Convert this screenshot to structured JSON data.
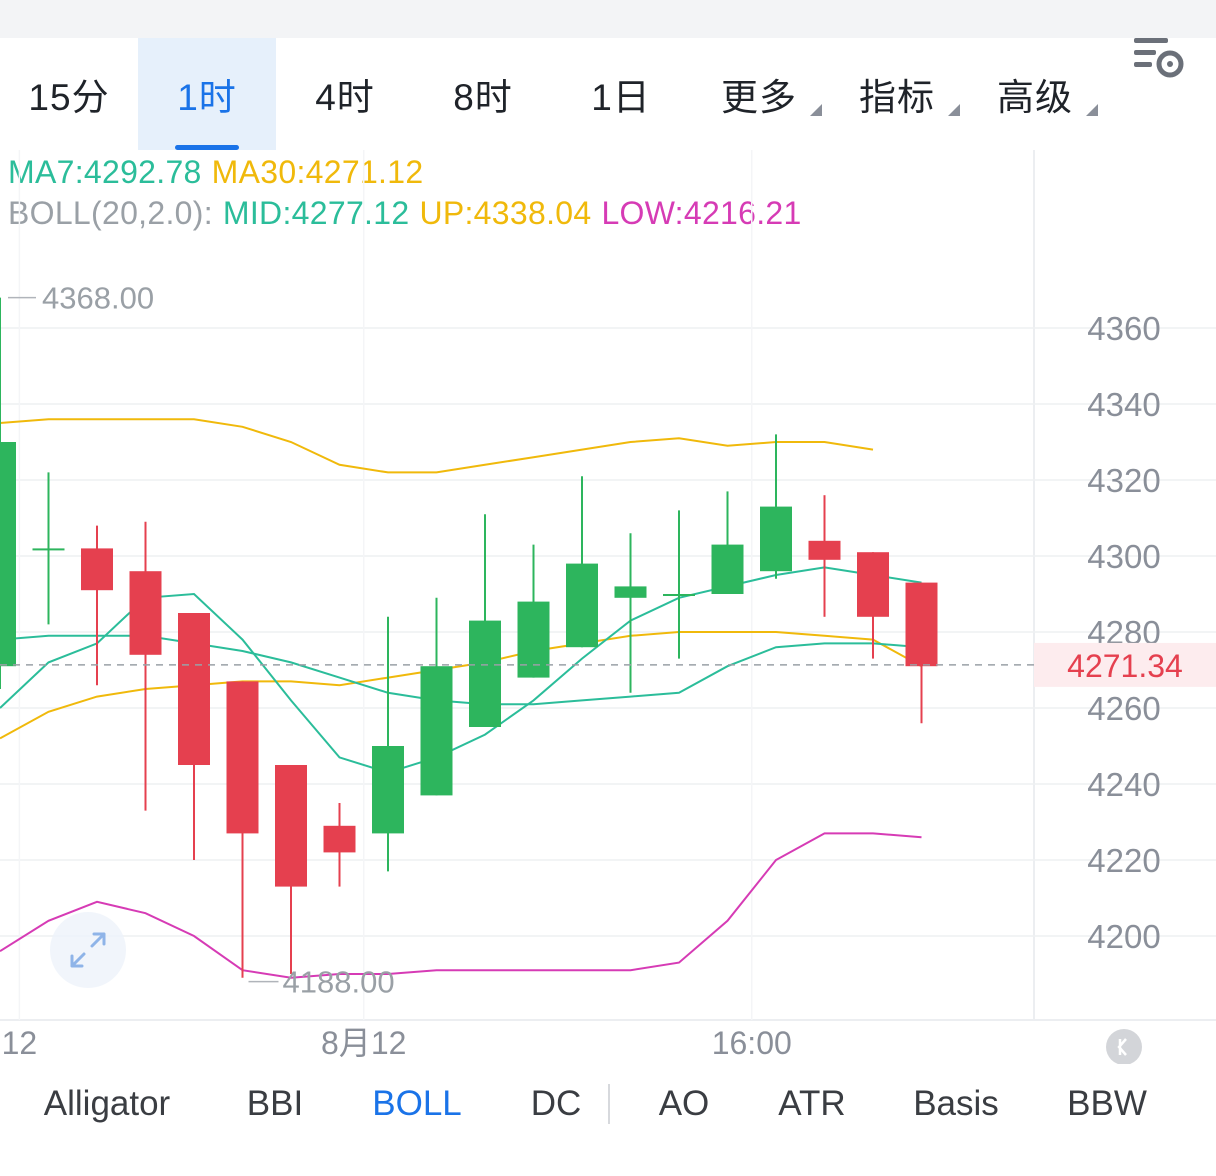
{
  "timeframe_tabs": [
    {
      "label": "15分",
      "active": false,
      "dropdown": false
    },
    {
      "label": "1时",
      "active": true,
      "dropdown": false
    },
    {
      "label": "4时",
      "active": false,
      "dropdown": false
    },
    {
      "label": "8时",
      "active": false,
      "dropdown": false
    },
    {
      "label": "1日",
      "active": false,
      "dropdown": false
    },
    {
      "label": "更多",
      "active": false,
      "dropdown": true
    },
    {
      "label": "指标",
      "active": false,
      "dropdown": true
    },
    {
      "label": "高级",
      "active": false,
      "dropdown": true
    }
  ],
  "settings_icon": "chart-settings-icon",
  "expand_icon": "expand-icon",
  "scroll_icon": "scroll-to-latest-icon",
  "legend": {
    "ma": [
      {
        "text": "MA7:4292.78",
        "color": "#2bbd9a"
      },
      {
        "text": "MA30:4271.12",
        "color": "#f0b90b"
      }
    ],
    "boll": [
      {
        "text": "BOLL(20,2.0):",
        "color": "#9aa0a6"
      },
      {
        "text": "MID:4277.12",
        "color": "#2bbd9a"
      },
      {
        "text": "UP:4338.04",
        "color": "#f0b90b"
      },
      {
        "text": "LOW:4216.21",
        "color": "#d63bb5"
      }
    ]
  },
  "indicators": [
    {
      "label": "Alligator",
      "active": false
    },
    {
      "label": "BBI",
      "active": false
    },
    {
      "label": "BOLL",
      "active": true
    },
    {
      "label": "DC",
      "active": false
    },
    {
      "label": "AO",
      "active": false
    },
    {
      "label": "ATR",
      "active": false
    },
    {
      "label": "Basis",
      "active": false
    },
    {
      "label": "BBW",
      "active": false
    }
  ],
  "colors": {
    "up": "#2db55d",
    "down": "#e5404f",
    "grid": "#eef0f2",
    "mid": "#2bbd9a",
    "upper": "#f0b90b",
    "lower": "#d63bb5",
    "ma": "#2bbd9a",
    "accent": "#1a73e8"
  },
  "chart_data": {
    "type": "candlestick",
    "ylim": [
      4182,
      4382
    ],
    "y_ticks": [
      4360,
      4340,
      4320,
      4300,
      4280,
      4260,
      4240,
      4220,
      4200
    ],
    "y_tick_labels": [
      "4360",
      "4340",
      "4320",
      "4300",
      "4280",
      "4260",
      "4240",
      "4220",
      "4200"
    ],
    "x_labels": [
      {
        "text": "12",
        "index": -0.6
      },
      {
        "text": "8月12",
        "index": 6.5
      },
      {
        "text": "16:00",
        "index": 14.5
      }
    ],
    "candles": [
      {
        "o": 4271,
        "h": 4368,
        "l": 4265,
        "c": 4330
      },
      {
        "o": 4302,
        "h": 4322,
        "l": 4282,
        "c": 4302
      },
      {
        "o": 4302,
        "h": 4308,
        "l": 4266,
        "c": 4291
      },
      {
        "o": 4296,
        "h": 4309,
        "l": 4233,
        "c": 4274
      },
      {
        "o": 4285,
        "h": 4285,
        "l": 4220,
        "c": 4245
      },
      {
        "o": 4267,
        "h": 4267,
        "l": 4189,
        "c": 4227
      },
      {
        "o": 4245,
        "h": 4245,
        "l": 4190,
        "c": 4213
      },
      {
        "o": 4229,
        "h": 4235,
        "l": 4213,
        "c": 4222
      },
      {
        "o": 4227,
        "h": 4284,
        "l": 4217,
        "c": 4250
      },
      {
        "o": 4237,
        "h": 4289,
        "l": 4237,
        "c": 4271
      },
      {
        "o": 4255,
        "h": 4311,
        "l": 4255,
        "c": 4283
      },
      {
        "o": 4268,
        "h": 4303,
        "l": 4268,
        "c": 4288
      },
      {
        "o": 4276,
        "h": 4321,
        "l": 4276,
        "c": 4298
      },
      {
        "o": 4289,
        "h": 4306,
        "l": 4264,
        "c": 4292
      },
      {
        "o": 4290,
        "h": 4312,
        "l": 4273,
        "c": 4290
      },
      {
        "o": 4290,
        "h": 4317,
        "l": 4290,
        "c": 4303
      },
      {
        "o": 4296,
        "h": 4332,
        "l": 4294,
        "c": 4313
      },
      {
        "o": 4304,
        "h": 4316,
        "l": 4284,
        "c": 4299
      },
      {
        "o": 4301,
        "h": 4301,
        "l": 4273,
        "c": 4284
      },
      {
        "o": 4293,
        "h": 4293,
        "l": 4256,
        "c": 4271
      }
    ],
    "boll_mid": [
      4278,
      4279,
      4279,
      4279,
      4277,
      4275,
      4272,
      4268,
      4264,
      4262,
      4261,
      4261,
      4262,
      4263,
      4264,
      4271,
      4276,
      4277,
      4277,
      4276
    ],
    "boll_upper": [
      4335,
      4336,
      4336,
      4336,
      4336,
      4334,
      4330,
      4324,
      4322,
      4322,
      4324,
      4326,
      4328,
      4330,
      4331,
      4329,
      4330,
      4330,
      4328
    ],
    "boll_lower": [
      4196,
      4204,
      4209,
      4206,
      4200,
      4191,
      4189,
      4190,
      4190,
      4191,
      4191,
      4191,
      4191,
      4191,
      4193,
      4204,
      4220,
      4227,
      4227,
      4226
    ],
    "ma_line": [
      4260,
      4272,
      4277,
      4289,
      4290,
      4278,
      4262,
      4247,
      4243,
      4247,
      4253,
      4262,
      4273,
      4283,
      4289,
      4292,
      4295,
      4297,
      4295,
      4293
    ],
    "ma30_line": [
      4252,
      4259,
      4263,
      4265,
      4266,
      4267,
      4267,
      4266,
      4268,
      4270,
      4272,
      4275,
      4277,
      4279,
      4280,
      4280,
      4280,
      4279,
      4278,
      4271
    ],
    "last_price": 4271.34,
    "last_price_label": "4271.34",
    "high_label": "4368.00",
    "low_label": "4188.00"
  }
}
